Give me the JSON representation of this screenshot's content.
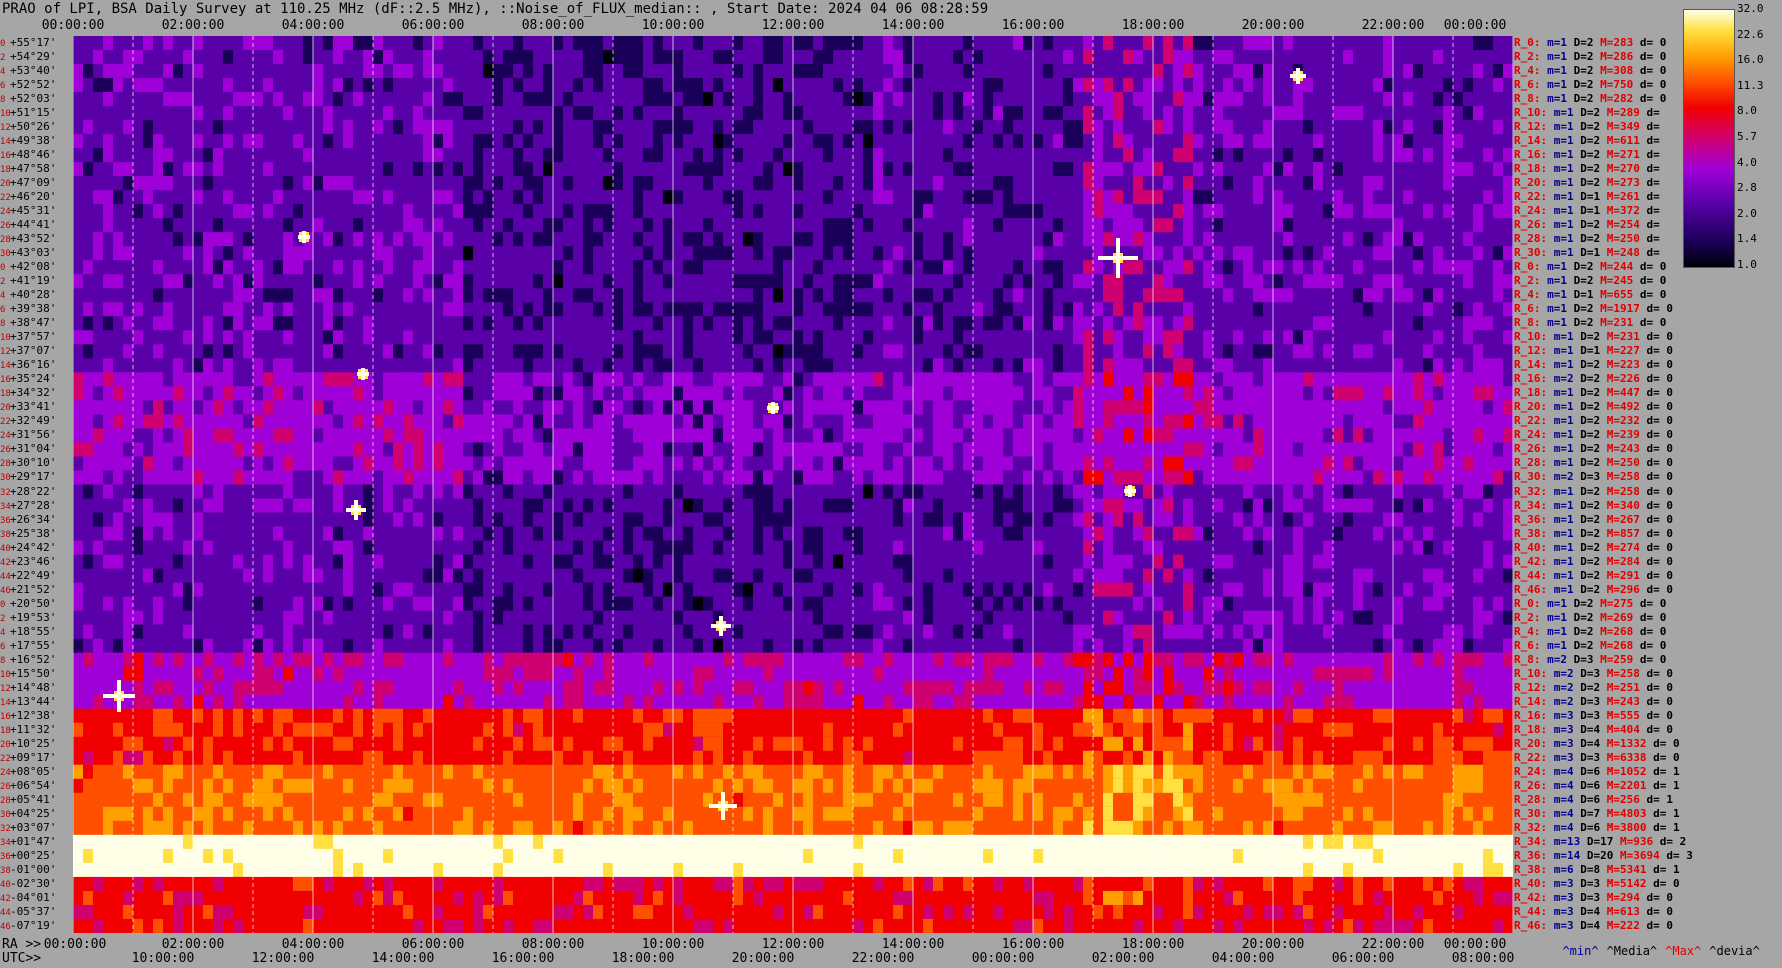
{
  "title": "PRAO of LPI, BSA Daily Survey at 110.25 MHz (dF::2.5 MHz), ::Noise_of_FLUX_median:: , Start Date: 2024 04 06 08:28:59",
  "axes": {
    "ra_prefix": "RA >>",
    "utc_prefix": "UTC>>",
    "top_ticks": [
      "00:00:00",
      "02:00:00",
      "04:00:00",
      "06:00:00",
      "08:00:00",
      "10:00:00",
      "12:00:00",
      "14:00:00",
      "16:00:00",
      "18:00:00",
      "20:00:00",
      "22:00:00",
      "00:00:00"
    ],
    "ra_ticks": [
      "00:00:00",
      "02:00:00",
      "04:00:00",
      "06:00:00",
      "08:00:00",
      "10:00:00",
      "12:00:00",
      "14:00:00",
      "16:00:00",
      "18:00:00",
      "20:00:00",
      "22:00:00",
      "00:00:00"
    ],
    "utc_ticks": [
      "10:00:00",
      "12:00:00",
      "14:00:00",
      "16:00:00",
      "18:00:00",
      "20:00:00",
      "22:00:00",
      "00:00:00",
      "02:00:00",
      "04:00:00",
      "06:00:00",
      "08:00:00"
    ]
  },
  "chart_data": {
    "type": "heatmap",
    "title": "PRAO of LPI, BSA Daily Survey at 110.25 MHz (dF::2.5 MHz), ::Noise_of_FLUX_median:: , Start Date: 2024 04 06 08:28:59",
    "xlabel": "RA / UTC",
    "xlim": [
      "00:00:00",
      "24:00:00"
    ],
    "colorscale": {
      "ticks": [
        32.0,
        22.6,
        16.0,
        11.3,
        8.0,
        5.7,
        4.0,
        2.8,
        2.0,
        1.4,
        1.0
      ],
      "colors": [
        "#000008",
        "#1a0058",
        "#5a00a8",
        "#a000d8",
        "#d00070",
        "#f00000",
        "#ff5000",
        "#ffa000",
        "#ffe040",
        "#ffffe8"
      ]
    },
    "rows": [
      {
        "i": "0",
        "dec": "+55°17'",
        "stat": "R_0:",
        "m": "m=1",
        "d": "D=2",
        "h": "M=283",
        "dv": "d= 0"
      },
      {
        "i": "2",
        "dec": "+54°29'",
        "stat": "R_2:",
        "m": "m=1",
        "d": "D=2",
        "h": "M=286",
        "dv": "d= 0"
      },
      {
        "i": "4",
        "dec": "+53°40'",
        "stat": "R_4:",
        "m": "m=1",
        "d": "D=2",
        "h": "M=308",
        "dv": "d= 0"
      },
      {
        "i": "6",
        "dec": "+52°52'",
        "stat": "R_6:",
        "m": "m=1",
        "d": "D=2",
        "h": "M=750",
        "dv": "d= 0"
      },
      {
        "i": "8",
        "dec": "+52°03'",
        "stat": "R_8:",
        "m": "m=1",
        "d": "D=2",
        "h": "M=282",
        "dv": "d= 0"
      },
      {
        "i": "10",
        "dec": "+51°15'",
        "stat": "R_10:",
        "m": "m=1",
        "d": "D=2",
        "h": "M=289",
        "dv": "d="
      },
      {
        "i": "12",
        "dec": "+50°26'",
        "stat": "R_12:",
        "m": "m=1",
        "d": "D=2",
        "h": "M=349",
        "dv": "d="
      },
      {
        "i": "14",
        "dec": "+49°38'",
        "stat": "R_14:",
        "m": "m=1",
        "d": "D=2",
        "h": "M=611",
        "dv": "d="
      },
      {
        "i": "16",
        "dec": "+48°46'",
        "stat": "R_16:",
        "m": "m=1",
        "d": "D=2",
        "h": "M=271",
        "dv": "d="
      },
      {
        "i": "18",
        "dec": "+47°58'",
        "stat": "R_18:",
        "m": "m=1",
        "d": "D=2",
        "h": "M=270",
        "dv": "d="
      },
      {
        "i": "20",
        "dec": "+47°09'",
        "stat": "R_20:",
        "m": "m=1",
        "d": "D=2",
        "h": "M=273",
        "dv": "d="
      },
      {
        "i": "22",
        "dec": "+46°20'",
        "stat": "R_22:",
        "m": "m=1",
        "d": "D=1",
        "h": "M=261",
        "dv": "d="
      },
      {
        "i": "24",
        "dec": "+45°31'",
        "stat": "R_24:",
        "m": "m=1",
        "d": "D=1",
        "h": "M=372",
        "dv": "d="
      },
      {
        "i": "26",
        "dec": "+44°41'",
        "stat": "R_26:",
        "m": "m=1",
        "d": "D=2",
        "h": "M=254",
        "dv": "d="
      },
      {
        "i": "28",
        "dec": "+43°52'",
        "stat": "R_28:",
        "m": "m=1",
        "d": "D=2",
        "h": "M=250",
        "dv": "d="
      },
      {
        "i": "30",
        "dec": "+43°03'",
        "stat": "R_30:",
        "m": "m=1",
        "d": "D=1",
        "h": "M=248",
        "dv": "d="
      },
      {
        "i": "0",
        "dec": "+42°08'",
        "stat": "R_0:",
        "m": "m=1",
        "d": "D=2",
        "h": "M=244",
        "dv": "d= 0"
      },
      {
        "i": "2",
        "dec": "+41°19'",
        "stat": "R_2:",
        "m": "m=1",
        "d": "D=2",
        "h": "M=245",
        "dv": "d= 0"
      },
      {
        "i": "4",
        "dec": "+40°28'",
        "stat": "R_4:",
        "m": "m=1",
        "d": "D=1",
        "h": "M=655",
        "dv": "d= 0"
      },
      {
        "i": "6",
        "dec": "+39°38'",
        "stat": "R_6:",
        "m": "m=1",
        "d": "D=2",
        "h": "M=1917",
        "dv": "d= 0"
      },
      {
        "i": "8",
        "dec": "+38°47'",
        "stat": "R_8:",
        "m": "m=1",
        "d": "D=2",
        "h": "M=231",
        "dv": "d= 0"
      },
      {
        "i": "10",
        "dec": "+37°57'",
        "stat": "R_10:",
        "m": "m=1",
        "d": "D=2",
        "h": "M=231",
        "dv": "d= 0"
      },
      {
        "i": "12",
        "dec": "+37°07'",
        "stat": "R_12:",
        "m": "m=1",
        "d": "D=1",
        "h": "M=227",
        "dv": "d= 0"
      },
      {
        "i": "14",
        "dec": "+36°16'",
        "stat": "R_14:",
        "m": "m=1",
        "d": "D=2",
        "h": "M=223",
        "dv": "d= 0"
      },
      {
        "i": "16",
        "dec": "+35°24'",
        "stat": "R_16:",
        "m": "m=2",
        "d": "D=2",
        "h": "M=226",
        "dv": "d= 0"
      },
      {
        "i": "18",
        "dec": "+34°32'",
        "stat": "R_18:",
        "m": "m=1",
        "d": "D=2",
        "h": "M=447",
        "dv": "d= 0"
      },
      {
        "i": "20",
        "dec": "+33°41'",
        "stat": "R_20:",
        "m": "m=1",
        "d": "D=2",
        "h": "M=492",
        "dv": "d= 0"
      },
      {
        "i": "22",
        "dec": "+32°49'",
        "stat": "R_22:",
        "m": "m=1",
        "d": "D=2",
        "h": "M=232",
        "dv": "d= 0"
      },
      {
        "i": "24",
        "dec": "+31°56'",
        "stat": "R_24:",
        "m": "m=1",
        "d": "D=2",
        "h": "M=239",
        "dv": "d= 0"
      },
      {
        "i": "26",
        "dec": "+31°04'",
        "stat": "R_26:",
        "m": "m=1",
        "d": "D=2",
        "h": "M=243",
        "dv": "d= 0"
      },
      {
        "i": "28",
        "dec": "+30°10'",
        "stat": "R_28:",
        "m": "m=1",
        "d": "D=2",
        "h": "M=250",
        "dv": "d= 0"
      },
      {
        "i": "30",
        "dec": "+29°17'",
        "stat": "R_30:",
        "m": "m=2",
        "d": "D=3",
        "h": "M=258",
        "dv": "d= 0"
      },
      {
        "i": "32",
        "dec": "+28°22'",
        "stat": "R_32:",
        "m": "m=1",
        "d": "D=2",
        "h": "M=258",
        "dv": "d= 0"
      },
      {
        "i": "34",
        "dec": "+27°28'",
        "stat": "R_34:",
        "m": "m=1",
        "d": "D=2",
        "h": "M=340",
        "dv": "d= 0"
      },
      {
        "i": "36",
        "dec": "+26°34'",
        "stat": "R_36:",
        "m": "m=1",
        "d": "D=2",
        "h": "M=267",
        "dv": "d= 0"
      },
      {
        "i": "38",
        "dec": "+25°38'",
        "stat": "R_38:",
        "m": "m=1",
        "d": "D=2",
        "h": "M=857",
        "dv": "d= 0"
      },
      {
        "i": "40",
        "dec": "+24°42'",
        "stat": "R_40:",
        "m": "m=1",
        "d": "D=2",
        "h": "M=274",
        "dv": "d= 0"
      },
      {
        "i": "42",
        "dec": "+23°46'",
        "stat": "R_42:",
        "m": "m=1",
        "d": "D=2",
        "h": "M=284",
        "dv": "d= 0"
      },
      {
        "i": "44",
        "dec": "+22°49'",
        "stat": "R_44:",
        "m": "m=1",
        "d": "D=2",
        "h": "M=291",
        "dv": "d= 0"
      },
      {
        "i": "46",
        "dec": "+21°52'",
        "stat": "R_46:",
        "m": "m=1",
        "d": "D=2",
        "h": "M=296",
        "dv": "d= 0"
      },
      {
        "i": "0",
        "dec": "+20°50'",
        "stat": "R_0:",
        "m": "m=1",
        "d": "D=2",
        "h": "M=275",
        "dv": "d= 0"
      },
      {
        "i": "2",
        "dec": "+19°53'",
        "stat": "R_2:",
        "m": "m=1",
        "d": "D=2",
        "h": "M=269",
        "dv": "d= 0"
      },
      {
        "i": "4",
        "dec": "+18°55'",
        "stat": "R_4:",
        "m": "m=1",
        "d": "D=2",
        "h": "M=268",
        "dv": "d= 0"
      },
      {
        "i": "6",
        "dec": "+17°55'",
        "stat": "R_6:",
        "m": "m=1",
        "d": "D=2",
        "h": "M=268",
        "dv": "d= 0"
      },
      {
        "i": "8",
        "dec": "+16°52'",
        "stat": "R_8:",
        "m": "m=2",
        "d": "D=3",
        "h": "M=259",
        "dv": "d= 0"
      },
      {
        "i": "10",
        "dec": "+15°50'",
        "stat": "R_10:",
        "m": "m=2",
        "d": "D=3",
        "h": "M=258",
        "dv": "d= 0"
      },
      {
        "i": "12",
        "dec": "+14°48'",
        "stat": "R_12:",
        "m": "m=2",
        "d": "D=2",
        "h": "M=251",
        "dv": "d= 0"
      },
      {
        "i": "14",
        "dec": "+13°44'",
        "stat": "R_14:",
        "m": "m=2",
        "d": "D=3",
        "h": "M=243",
        "dv": "d= 0"
      },
      {
        "i": "16",
        "dec": "+12°38'",
        "stat": "R_16:",
        "m": "m=3",
        "d": "D=3",
        "h": "M=555",
        "dv": "d= 0"
      },
      {
        "i": "18",
        "dec": "+11°32'",
        "stat": "R_18:",
        "m": "m=3",
        "d": "D=4",
        "h": "M=404",
        "dv": "d= 0"
      },
      {
        "i": "20",
        "dec": "+10°25'",
        "stat": "R_20:",
        "m": "m=3",
        "d": "D=4",
        "h": "M=1332",
        "dv": "d= 0"
      },
      {
        "i": "22",
        "dec": "+09°17'",
        "stat": "R_22:",
        "m": "m=3",
        "d": "D=3",
        "h": "M=6338",
        "dv": "d= 0"
      },
      {
        "i": "24",
        "dec": "+08°05'",
        "stat": "R_24:",
        "m": "m=4",
        "d": "D=6",
        "h": "M=1052",
        "dv": "d= 1"
      },
      {
        "i": "26",
        "dec": "+06°54'",
        "stat": "R_26:",
        "m": "m=4",
        "d": "D=6",
        "h": "M=2201",
        "dv": "d= 1"
      },
      {
        "i": "28",
        "dec": "+05°41'",
        "stat": "R_28:",
        "m": "m=4",
        "d": "D=6",
        "h": "M=256",
        "dv": "d= 1"
      },
      {
        "i": "30",
        "dec": "+04°25'",
        "stat": "R_30:",
        "m": "m=4",
        "d": "D=7",
        "h": "M=4803",
        "dv": "d= 1"
      },
      {
        "i": "32",
        "dec": "+03°07'",
        "stat": "R_32:",
        "m": "m=4",
        "d": "D=6",
        "h": "M=3800",
        "dv": "d= 1"
      },
      {
        "i": "34",
        "dec": "+01°47'",
        "stat": "R_34:",
        "m": "m=13",
        "d": "D=17",
        "h": "M=936",
        "dv": "d= 2"
      },
      {
        "i": "36",
        "dec": "+00°25'",
        "stat": "R_36:",
        "m": "m=14",
        "d": "D=20",
        "h": "M=3694",
        "dv": "d= 3"
      },
      {
        "i": "38",
        "dec": "-01°00'",
        "stat": "R_38:",
        "m": "m=6",
        "d": "D=8",
        "h": "M=5341",
        "dv": "d= 1"
      },
      {
        "i": "40",
        "dec": "-02°30'",
        "stat": "R_40:",
        "m": "m=3",
        "d": "D=3",
        "h": "M=5142",
        "dv": "d= 0"
      },
      {
        "i": "42",
        "dec": "-04°01'",
        "stat": "R_42:",
        "m": "m=3",
        "d": "D=3",
        "h": "M=294",
        "dv": "d= 0"
      },
      {
        "i": "44",
        "dec": "-05°37'",
        "stat": "R_44:",
        "m": "m=3",
        "d": "D=4",
        "h": "M=613",
        "dv": "d= 0"
      },
      {
        "i": "46",
        "dec": "-07°19'",
        "stat": "R_46:",
        "m": "m=3",
        "d": "D=4",
        "h": "M=222",
        "dv": "d= 0"
      }
    ]
  },
  "legend": {
    "min": "^min^",
    "median": "^Media^",
    "max": "^Max^",
    "dev": "^devia^",
    "colors": {
      "min": "#00008c",
      "median": "#000000",
      "max": "#e00000",
      "dev": "#000000"
    }
  }
}
